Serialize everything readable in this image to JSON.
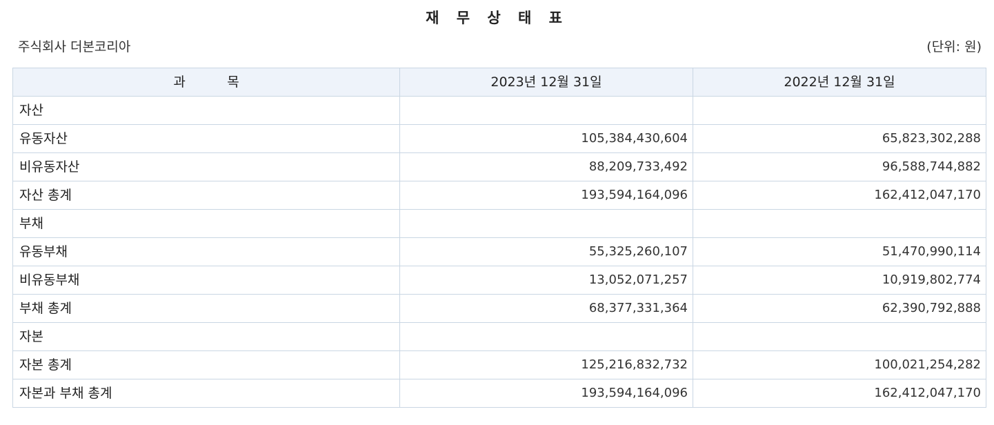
{
  "title": "재 무 상 태 표",
  "company": "주식회사 더본코리아",
  "unit": "(단위: 원)",
  "table": {
    "headers": [
      "과          목",
      "2023년 12월 31일",
      "2022년 12월 31일"
    ],
    "rows": [
      {
        "label": "자산",
        "y2023": "",
        "y2022": ""
      },
      {
        "label": "유동자산",
        "y2023": "105,384,430,604",
        "y2022": "65,823,302,288"
      },
      {
        "label": "비유동자산",
        "y2023": "88,209,733,492",
        "y2022": "96,588,744,882"
      },
      {
        "label": "자산 총계",
        "y2023": "193,594,164,096",
        "y2022": "162,412,047,170"
      },
      {
        "label": "부채",
        "y2023": "",
        "y2022": ""
      },
      {
        "label": "유동부채",
        "y2023": "55,325,260,107",
        "y2022": "51,470,990,114"
      },
      {
        "label": "비유동부채",
        "y2023": "13,052,071,257",
        "y2022": "10,919,802,774"
      },
      {
        "label": "부채 총계",
        "y2023": "68,377,331,364",
        "y2022": "62,390,792,888"
      },
      {
        "label": "자본",
        "y2023": "",
        "y2022": ""
      },
      {
        "label": "자본 총계",
        "y2023": "125,216,832,732",
        "y2022": "100,021,254,282"
      },
      {
        "label": "자본과 부채 총계",
        "y2023": "193,594,164,096",
        "y2022": "162,412,047,170"
      }
    ]
  }
}
